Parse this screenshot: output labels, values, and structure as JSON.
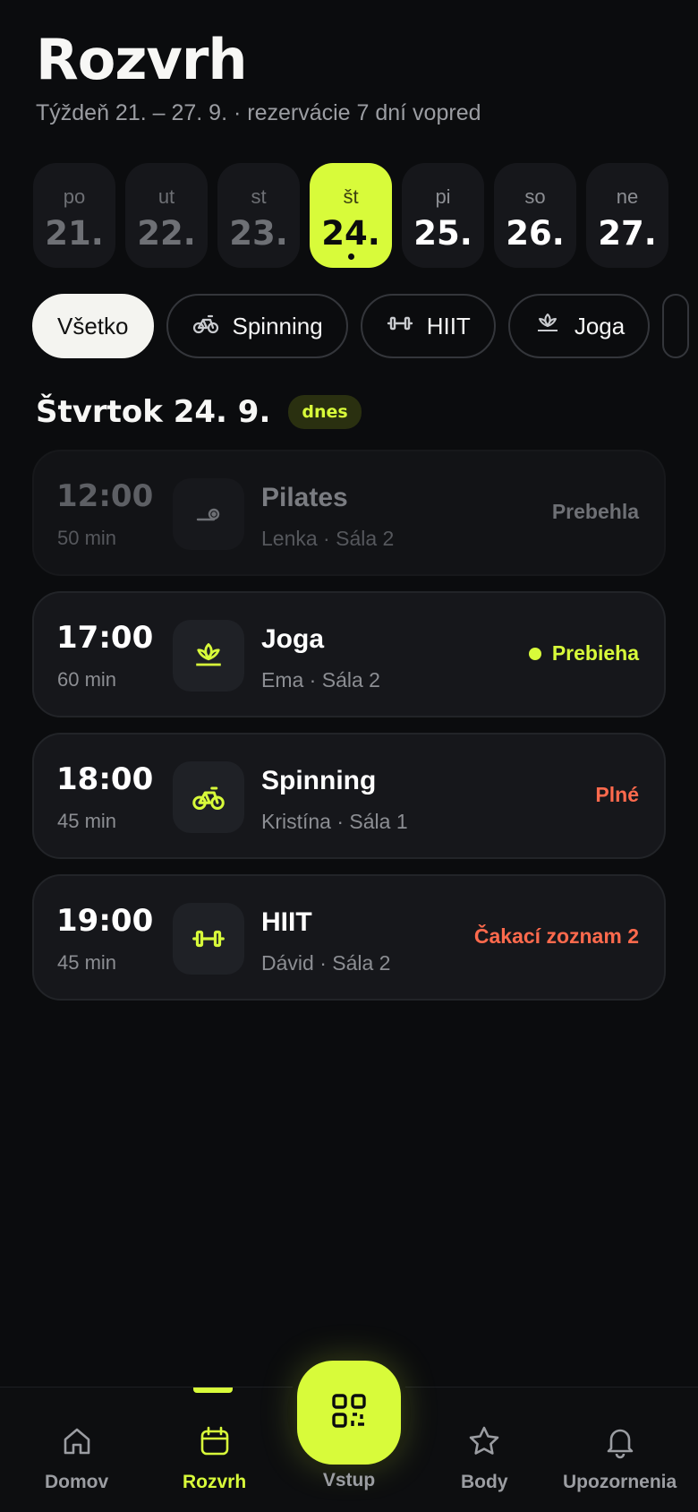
{
  "header": {
    "title": "Rozvrh",
    "subtitle": "Týždeň 21. – 27. 9. · rezervácie 7 dní vopred"
  },
  "days": [
    {
      "name": "po",
      "num": "21.",
      "state": "past"
    },
    {
      "name": "ut",
      "num": "22.",
      "state": "past"
    },
    {
      "name": "st",
      "num": "23.",
      "state": "past"
    },
    {
      "name": "št",
      "num": "24.",
      "state": "active"
    },
    {
      "name": "pi",
      "num": "25.",
      "state": "future"
    },
    {
      "name": "so",
      "num": "26.",
      "state": "future"
    },
    {
      "name": "ne",
      "num": "27.",
      "state": "future"
    }
  ],
  "filters": [
    {
      "label": "Všetko",
      "icon": "none",
      "selected": true
    },
    {
      "label": "Spinning",
      "icon": "bicycle-icon"
    },
    {
      "label": "HIIT",
      "icon": "dumbbell-icon"
    },
    {
      "label": "Joga",
      "icon": "lotus-icon"
    }
  ],
  "day_heading": {
    "title": "Štvrtok 24. 9.",
    "badge": "dnes"
  },
  "classes": [
    {
      "time": "12:00",
      "duration": "50 min",
      "name": "Pilates",
      "meta": "Lenka · Sála 2",
      "status": "Prebehla",
      "icon": "pilates-icon",
      "state": "past"
    },
    {
      "time": "17:00",
      "duration": "60 min",
      "name": "Joga",
      "meta": "Ema · Sála 2",
      "status": "Prebieha",
      "icon": "lotus-icon",
      "state": "live"
    },
    {
      "time": "18:00",
      "duration": "45 min",
      "name": "Spinning",
      "meta": "Kristína · Sála 1",
      "status": "Plné",
      "icon": "bicycle-icon",
      "state": "full"
    },
    {
      "time": "19:00",
      "duration": "45 min",
      "name": "HIIT",
      "meta": "Dávid · Sála 2",
      "status": "Čakací zoznam 2",
      "icon": "dumbbell-icon",
      "state": "waitlist"
    }
  ],
  "nav": {
    "home": "Domov",
    "schedule": "Rozvrh",
    "entry": "Vstup",
    "points": "Body",
    "notifications": "Upozornenia"
  },
  "colors": {
    "accent": "#d8fb3a",
    "alert": "#ff6a4d",
    "background": "#0b0c0e"
  }
}
